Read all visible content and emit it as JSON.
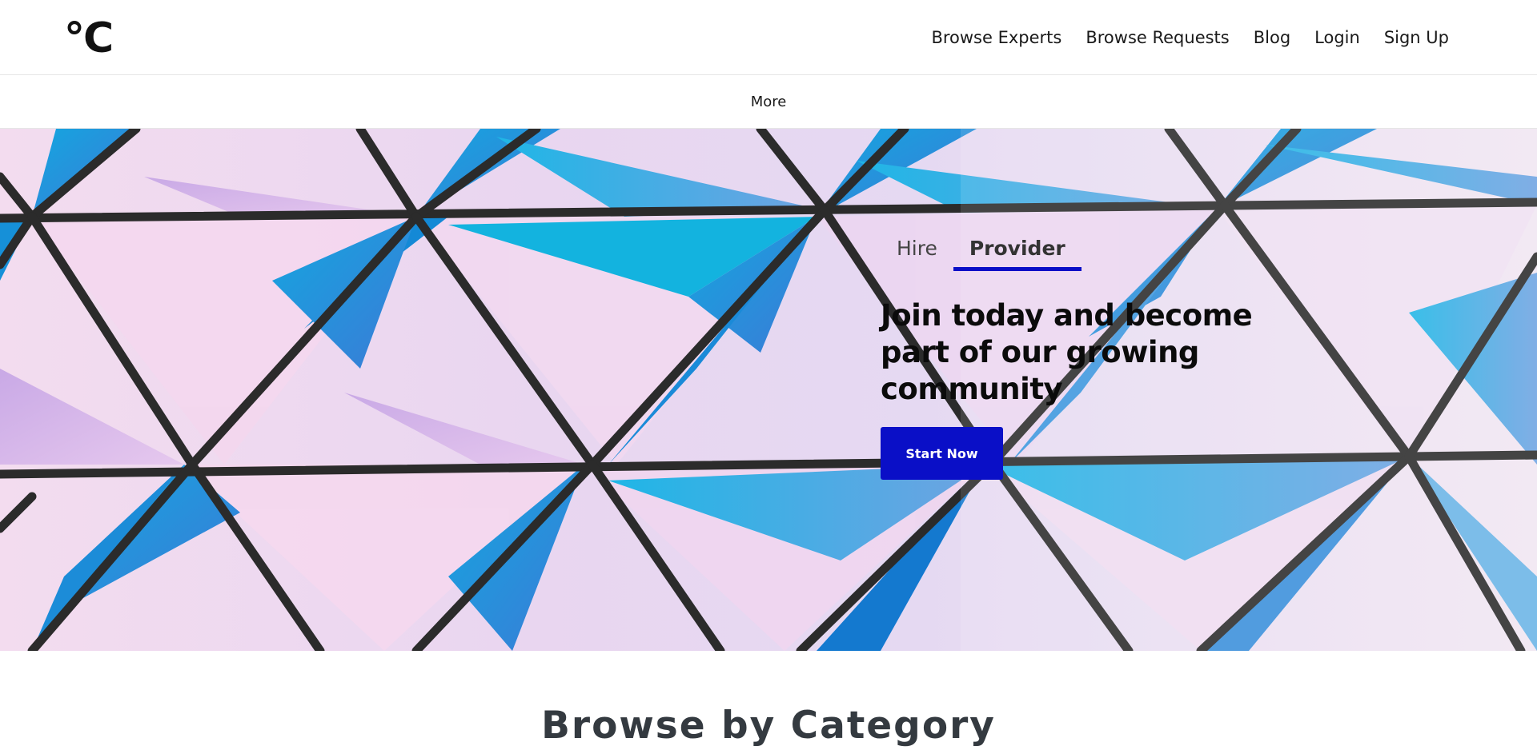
{
  "brand": {
    "logo_text": "°C"
  },
  "nav": {
    "items": [
      "Browse Experts",
      "Browse Requests",
      "Blog",
      "Login",
      "Sign Up"
    ]
  },
  "subnav": {
    "more_label": "More"
  },
  "hero": {
    "tabs": [
      {
        "label": "Hire",
        "active": false
      },
      {
        "label": "Provider",
        "active": true
      }
    ],
    "headline": "Join today and become part of our growing community",
    "cta_label": "Start Now",
    "accent_color": "#0a0fc7"
  },
  "section": {
    "title": "Browse by Category"
  },
  "icons": [
    "logo-degree-celsius"
  ]
}
